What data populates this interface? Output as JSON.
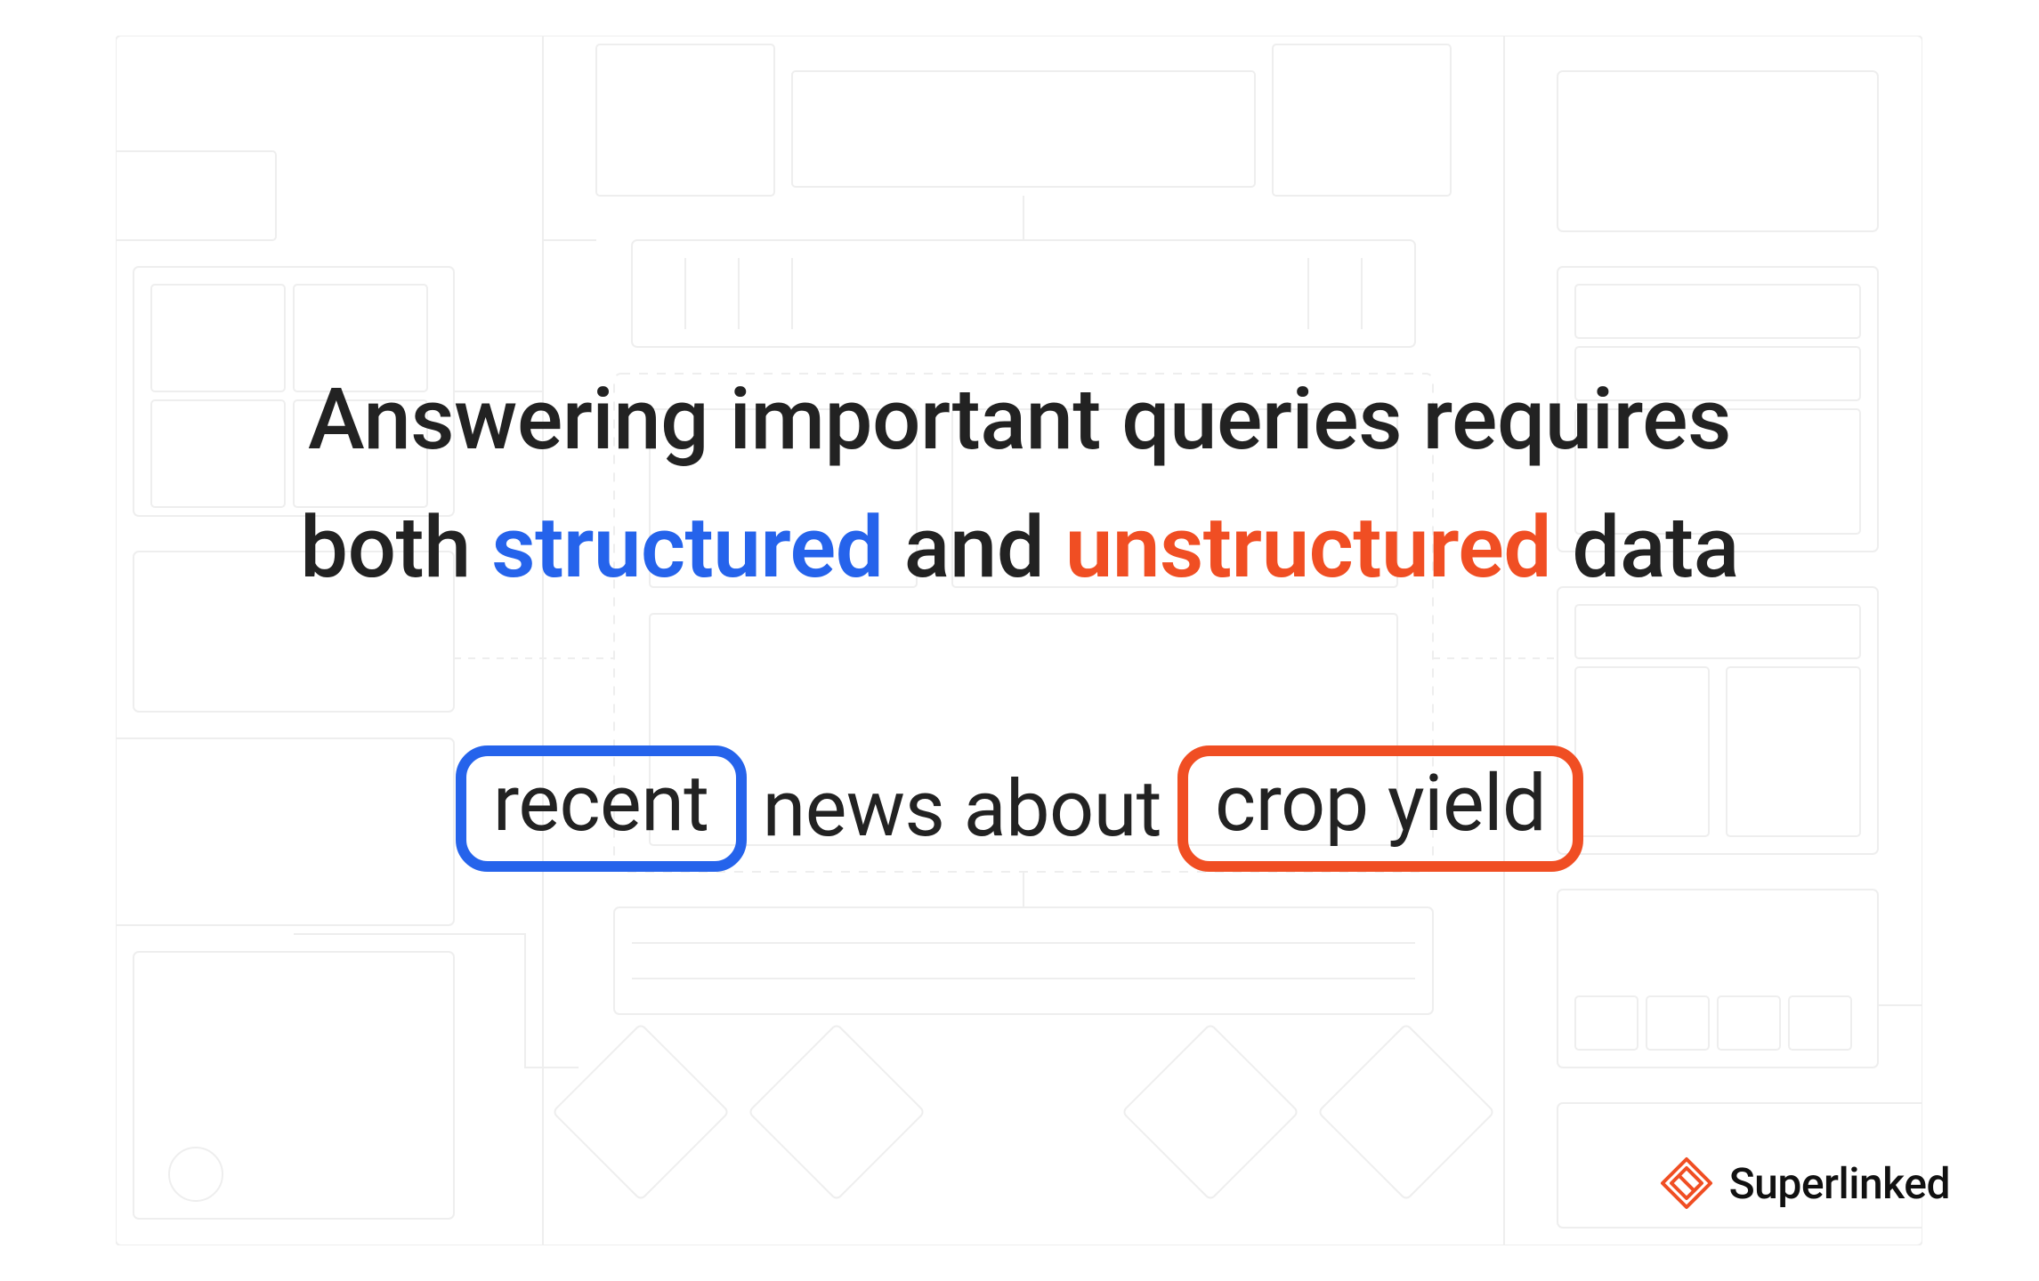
{
  "headline": {
    "line1_prefix": "Answering important queries requires",
    "line2_prefix": "both ",
    "structured": "structured",
    "line2_mid": " and ",
    "unstructured": "unstructured",
    "line2_suffix": " data"
  },
  "example": {
    "word1": "recent",
    "word2": "news about",
    "word3": "crop yield"
  },
  "brand": {
    "name": "Superlinked"
  },
  "colors": {
    "blue": "#2563eb",
    "orange": "#f04e23",
    "text": "#222222"
  }
}
